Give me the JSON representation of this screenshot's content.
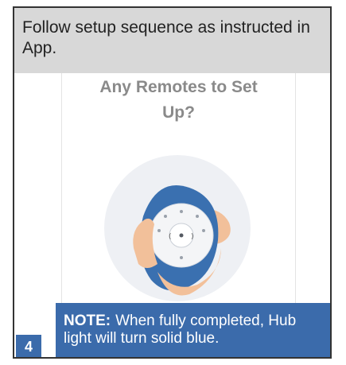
{
  "header": {
    "text": "Follow setup sequence as instructed in App."
  },
  "screen": {
    "title_line1": "Any Remotes to Set",
    "title_line2": "Up?"
  },
  "illustration": {
    "icon": "hand-holding-remote-icon"
  },
  "note": {
    "label": "NOTE:",
    "text": "When fully completed, Hub light will turn solid blue."
  },
  "step": {
    "number": "4"
  },
  "colors": {
    "header_bg": "#d8d8d8",
    "accent": "#3b6bab",
    "title_gray": "#8a8a8a"
  }
}
